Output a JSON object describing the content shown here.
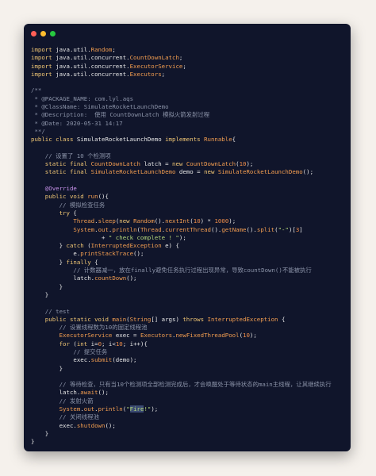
{
  "window": {
    "dots": [
      "close",
      "minimize",
      "maximize"
    ],
    "colors": {
      "background": "#10152b",
      "close": "#ff5f56",
      "minimize": "#ffbd2e",
      "maximize": "#27c93f"
    }
  },
  "code": {
    "language": "java",
    "lines": [
      [
        [
          "kw",
          "import "
        ],
        [
          "plain",
          "java.util."
        ],
        [
          "cls",
          "Random"
        ],
        [
          "plain",
          ";"
        ]
      ],
      [
        [
          "kw",
          "import "
        ],
        [
          "plain",
          "java.util.concurrent."
        ],
        [
          "cls",
          "CountDownLatch"
        ],
        [
          "plain",
          ";"
        ]
      ],
      [
        [
          "kw",
          "import "
        ],
        [
          "plain",
          "java.util.concurrent."
        ],
        [
          "cls",
          "ExecutorService"
        ],
        [
          "plain",
          ";"
        ]
      ],
      [
        [
          "kw",
          "import "
        ],
        [
          "plain",
          "java.util.concurrent."
        ],
        [
          "cls",
          "Executors"
        ],
        [
          "plain",
          ";"
        ]
      ],
      [],
      [
        [
          "cmt",
          "/**"
        ]
      ],
      [
        [
          "cmt",
          " * @PACKAGE_NAME: com.lyl.aqs"
        ]
      ],
      [
        [
          "cmt",
          " * @ClassName: SimulateRocketLaunchDemo"
        ]
      ],
      [
        [
          "cmt",
          " * @Description:  使用 CountDownLatch 模拟火箭发射过程"
        ]
      ],
      [
        [
          "cmt",
          " * @Date: 2020-05-31 14:17"
        ]
      ],
      [
        [
          "cmt",
          " **/"
        ]
      ],
      [
        [
          "kw",
          "public class "
        ],
        [
          "plain",
          "SimulateRocketLaunchDemo "
        ],
        [
          "kw",
          "implements "
        ],
        [
          "cls",
          "Runnable"
        ],
        [
          "plain",
          "{"
        ]
      ],
      [],
      [
        [
          "cmt",
          "    // 设置了 10 个检测项"
        ]
      ],
      [
        [
          "kw",
          "    static final "
        ],
        [
          "cls",
          "CountDownLatch "
        ],
        [
          "plain",
          "latch = "
        ],
        [
          "kw",
          "new "
        ],
        [
          "cls",
          "CountDownLatch"
        ],
        [
          "plain",
          "("
        ],
        [
          "num",
          "10"
        ],
        [
          "plain",
          ");"
        ]
      ],
      [
        [
          "kw",
          "    static final "
        ],
        [
          "cls",
          "SimulateRocketLaunchDemo "
        ],
        [
          "plain",
          "demo = "
        ],
        [
          "kw",
          "new "
        ],
        [
          "cls",
          "SimulateRocketLaunchDemo"
        ],
        [
          "plain",
          "();"
        ]
      ],
      [],
      [
        [
          "anno",
          "    @Override"
        ]
      ],
      [
        [
          "kw",
          "    public void "
        ],
        [
          "method",
          "run"
        ],
        [
          "plain",
          "(){"
        ]
      ],
      [
        [
          "cmt",
          "        // 模拟检查任务"
        ]
      ],
      [
        [
          "kw",
          "        try "
        ],
        [
          "plain",
          "{"
        ]
      ],
      [
        [
          "plain",
          "            "
        ],
        [
          "cls",
          "Thread"
        ],
        [
          "plain",
          "."
        ],
        [
          "method",
          "sleep"
        ],
        [
          "plain",
          "("
        ],
        [
          "kw",
          "new "
        ],
        [
          "cls",
          "Random"
        ],
        [
          "plain",
          "()."
        ],
        [
          "method",
          "nextInt"
        ],
        [
          "plain",
          "("
        ],
        [
          "num",
          "10"
        ],
        [
          "plain",
          ") * "
        ],
        [
          "num",
          "1000"
        ],
        [
          "plain",
          ");"
        ]
      ],
      [
        [
          "plain",
          "            "
        ],
        [
          "cls",
          "System"
        ],
        [
          "plain",
          "."
        ],
        [
          "method",
          "out"
        ],
        [
          "plain",
          "."
        ],
        [
          "method",
          "println"
        ],
        [
          "plain",
          "("
        ],
        [
          "cls",
          "Thread"
        ],
        [
          "plain",
          "."
        ],
        [
          "method",
          "currentThread"
        ],
        [
          "plain",
          "()."
        ],
        [
          "method",
          "getName"
        ],
        [
          "plain",
          "()."
        ],
        [
          "method",
          "split"
        ],
        [
          "plain",
          "("
        ],
        [
          "str",
          "\"-\""
        ],
        [
          "plain",
          ")["
        ],
        [
          "num",
          "3"
        ],
        [
          "plain",
          "]"
        ]
      ],
      [
        [
          "plain",
          "                    + "
        ],
        [
          "str",
          "\" check complete ! \""
        ],
        [
          "plain",
          ");"
        ]
      ],
      [
        [
          "plain",
          "        } "
        ],
        [
          "kw",
          "catch "
        ],
        [
          "plain",
          "("
        ],
        [
          "cls",
          "InterruptedException "
        ],
        [
          "plain",
          "e) {"
        ]
      ],
      [
        [
          "plain",
          "            e."
        ],
        [
          "method",
          "printStackTrace"
        ],
        [
          "plain",
          "();"
        ]
      ],
      [
        [
          "plain",
          "        } "
        ],
        [
          "kw",
          "finally "
        ],
        [
          "plain",
          "{"
        ]
      ],
      [
        [
          "cmt",
          "            // 计数器减一，放在finally避免任务执行过程出现异常，导致countDown()不能被执行"
        ]
      ],
      [
        [
          "plain",
          "            latch."
        ],
        [
          "method",
          "countDown"
        ],
        [
          "plain",
          "();"
        ]
      ],
      [
        [
          "plain",
          "        }"
        ]
      ],
      [
        [
          "plain",
          "    }"
        ]
      ],
      [],
      [
        [
          "cmt",
          "    // test"
        ]
      ],
      [
        [
          "kw",
          "    public static void "
        ],
        [
          "method",
          "main"
        ],
        [
          "plain",
          "("
        ],
        [
          "cls",
          "String"
        ],
        [
          "plain",
          "[] args) "
        ],
        [
          "kw",
          "throws "
        ],
        [
          "cls",
          "InterruptedException "
        ],
        [
          "plain",
          "{"
        ]
      ],
      [
        [
          "cmt",
          "        // 设置线程数为10的固定线程池"
        ]
      ],
      [
        [
          "plain",
          "        "
        ],
        [
          "cls",
          "ExecutorService "
        ],
        [
          "plain",
          "exec = "
        ],
        [
          "cls",
          "Executors"
        ],
        [
          "plain",
          "."
        ],
        [
          "method",
          "newFixedThreadPool"
        ],
        [
          "plain",
          "("
        ],
        [
          "num",
          "10"
        ],
        [
          "plain",
          ");"
        ]
      ],
      [
        [
          "kw",
          "        for "
        ],
        [
          "plain",
          "("
        ],
        [
          "kw",
          "int "
        ],
        [
          "plain",
          "i="
        ],
        [
          "num",
          "0"
        ],
        [
          "plain",
          "; i<"
        ],
        [
          "num",
          "10"
        ],
        [
          "plain",
          "; i++){"
        ]
      ],
      [
        [
          "cmt",
          "            // 提交任务"
        ]
      ],
      [
        [
          "plain",
          "            exec."
        ],
        [
          "method",
          "submit"
        ],
        [
          "plain",
          "(demo);"
        ]
      ],
      [
        [
          "plain",
          "        }"
        ]
      ],
      [],
      [
        [
          "cmt",
          "        // 等待检查，只有当10个检测项全部检测完成后，才会唤醒处于等待状态的main主线程，让其继续执行"
        ]
      ],
      [
        [
          "plain",
          "        latch."
        ],
        [
          "method",
          "await"
        ],
        [
          "plain",
          "();"
        ]
      ],
      [
        [
          "cmt",
          "        // 发射火箭"
        ]
      ],
      [
        [
          "plain",
          "        "
        ],
        [
          "cls",
          "System"
        ],
        [
          "plain",
          "."
        ],
        [
          "method",
          "out"
        ],
        [
          "plain",
          "."
        ],
        [
          "method",
          "println"
        ],
        [
          "plain",
          "("
        ],
        [
          "str",
          "\""
        ],
        [
          "str-hl",
          "Fire"
        ],
        [
          "str",
          "!\""
        ],
        [
          "plain",
          ");"
        ]
      ],
      [
        [
          "cmt",
          "        // 关闭线程池"
        ]
      ],
      [
        [
          "plain",
          "        exec."
        ],
        [
          "method",
          "shutdown"
        ],
        [
          "plain",
          "();"
        ]
      ],
      [
        [
          "plain",
          "    }"
        ]
      ],
      [
        [
          "plain",
          "}"
        ]
      ]
    ]
  }
}
